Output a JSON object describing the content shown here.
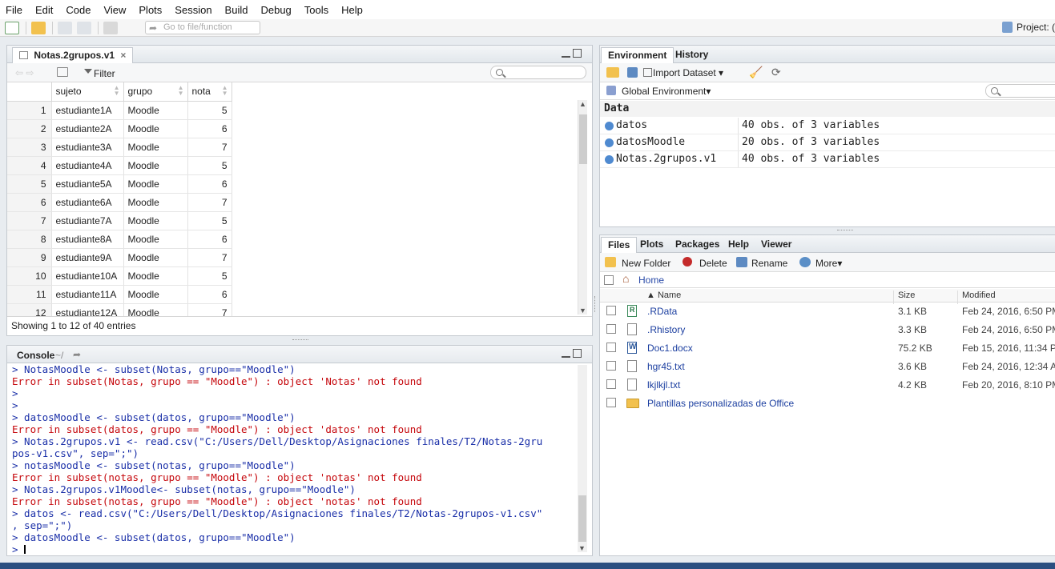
{
  "menu": [
    "File",
    "Edit",
    "Code",
    "View",
    "Plots",
    "Session",
    "Build",
    "Debug",
    "Tools",
    "Help"
  ],
  "toolbar": {
    "goto_placeholder": "Go to file/function",
    "project_label": "Project: ("
  },
  "viewer": {
    "tab_label": "Notas.2grupos.v1",
    "close_glyph": "×",
    "filter_label": "Filter",
    "columns": [
      "sujeto",
      "grupo",
      "nota"
    ],
    "rows": [
      [
        "1",
        "estudiante1A",
        "Moodle",
        "5"
      ],
      [
        "2",
        "estudiante2A",
        "Moodle",
        "6"
      ],
      [
        "3",
        "estudiante3A",
        "Moodle",
        "7"
      ],
      [
        "4",
        "estudiante4A",
        "Moodle",
        "5"
      ],
      [
        "5",
        "estudiante5A",
        "Moodle",
        "6"
      ],
      [
        "6",
        "estudiante6A",
        "Moodle",
        "7"
      ],
      [
        "7",
        "estudiante7A",
        "Moodle",
        "5"
      ],
      [
        "8",
        "estudiante8A",
        "Moodle",
        "6"
      ],
      [
        "9",
        "estudiante9A",
        "Moodle",
        "7"
      ],
      [
        "10",
        "estudiante10A",
        "Moodle",
        "5"
      ],
      [
        "11",
        "estudiante11A",
        "Moodle",
        "6"
      ],
      [
        "12",
        "estudiante12A",
        "Moodle",
        "7"
      ]
    ],
    "status": "Showing 1 to 12 of 40 entries"
  },
  "console": {
    "title": "Console",
    "path": "~/",
    "lines": [
      {
        "type": "cmd",
        "text": "> NotasMoodle <- subset(Notas, grupo==\"Moodle\")"
      },
      {
        "type": "err",
        "text": "Error in subset(Notas, grupo == \"Moodle\") : object 'Notas' not found"
      },
      {
        "type": "cmd",
        "text": ">"
      },
      {
        "type": "cmd",
        "text": ">"
      },
      {
        "type": "cmd",
        "text": "> datosMoodle <- subset(datos, grupo==\"Moodle\")"
      },
      {
        "type": "err",
        "text": "Error in subset(datos, grupo == \"Moodle\") : object 'datos' not found"
      },
      {
        "type": "cmd",
        "text": "> Notas.2grupos.v1 <- read.csv(\"C:/Users/Dell/Desktop/Asignaciones finales/T2/Notas-2gru"
      },
      {
        "type": "cmd",
        "text": "pos-v1.csv\", sep=\";\")"
      },
      {
        "type": "cmd",
        "text": "> notasMoodle <- subset(notas, grupo==\"Moodle\")"
      },
      {
        "type": "err",
        "text": "Error in subset(notas, grupo == \"Moodle\") : object 'notas' not found"
      },
      {
        "type": "cmd",
        "text": "> Notas.2grupos.v1Moodle<- subset(notas, grupo==\"Moodle\")"
      },
      {
        "type": "err",
        "text": "Error in subset(notas, grupo == \"Moodle\") : object 'notas' not found"
      },
      {
        "type": "cmd",
        "text": "> datos <- read.csv(\"C:/Users/Dell/Desktop/Asignaciones finales/T2/Notas-2grupos-v1.csv\""
      },
      {
        "type": "cmd",
        "text": ", sep=\";\")"
      },
      {
        "type": "cmd",
        "text": "> datosMoodle <- subset(datos, grupo==\"Moodle\")"
      }
    ],
    "prompt": ">"
  },
  "env": {
    "tabs": [
      "Environment",
      "History"
    ],
    "import_label": "Import Dataset",
    "scope_label": "Global Environment",
    "section": "Data",
    "items": [
      {
        "name": "datos",
        "value": "40 obs. of 3 variables"
      },
      {
        "name": "datosMoodle",
        "value": "20 obs. of 3 variables"
      },
      {
        "name": "Notas.2grupos.v1",
        "value": "40 obs. of 3 variables"
      }
    ]
  },
  "files": {
    "tabs": [
      "Files",
      "Plots",
      "Packages",
      "Help",
      "Viewer"
    ],
    "toolbar": {
      "new_folder": "New Folder",
      "delete": "Delete",
      "rename": "Rename",
      "more": "More"
    },
    "breadcrumb": "Home",
    "columns": {
      "name": "▲ Name",
      "size": "Size",
      "modified": "Modified"
    },
    "items": [
      {
        "name": ".RData",
        "size": "3.1 KB",
        "modified": "Feb 24, 2016, 6:50 PM",
        "icon": "r-data-icon"
      },
      {
        "name": ".Rhistory",
        "size": "3.3 KB",
        "modified": "Feb 24, 2016, 6:50 PM",
        "icon": "history-icon"
      },
      {
        "name": "Doc1.docx",
        "size": "75.2 KB",
        "modified": "Feb 15, 2016, 11:34 PM",
        "icon": "word-icon"
      },
      {
        "name": "hgr45.txt",
        "size": "3.6 KB",
        "modified": "Feb 24, 2016, 12:34 AM",
        "icon": "text-file-icon"
      },
      {
        "name": "lkjlkjl.txt",
        "size": "4.2 KB",
        "modified": "Feb 20, 2016, 8:10 PM",
        "icon": "text-file-icon"
      },
      {
        "name": "Plantillas personalizadas de Office",
        "size": "",
        "modified": "",
        "icon": "folder-icon"
      }
    ]
  }
}
